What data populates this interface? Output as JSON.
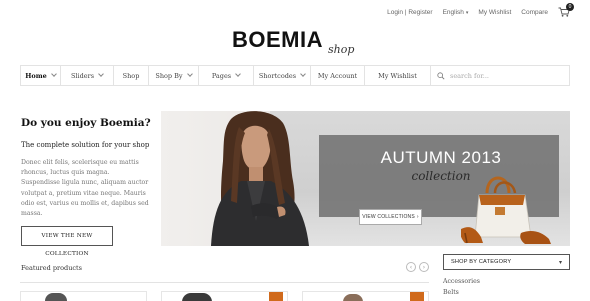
{
  "top_links": {
    "login": "Login | Register",
    "language": "English",
    "wishlist": "My Wishlist",
    "compare": "Compare",
    "cart_count": "0"
  },
  "logo": {
    "main": "BOEMIA",
    "sub": "shop"
  },
  "nav": {
    "items": [
      {
        "label": "Home",
        "dropdown": true
      },
      {
        "label": "Sliders",
        "dropdown": true
      },
      {
        "label": "Shop",
        "dropdown": false
      },
      {
        "label": "Shop By",
        "dropdown": true
      },
      {
        "label": "Pages",
        "dropdown": true
      },
      {
        "label": "Shortcodes",
        "dropdown": true
      },
      {
        "label": "My Account",
        "dropdown": false
      },
      {
        "label": "My Wishlist",
        "dropdown": false
      }
    ],
    "search_placeholder": "search for..."
  },
  "promo": {
    "heading": "Do you enjoy Boemia?",
    "subheading": "The complete solution for your shop",
    "body": "Donec elit felis, scelerisque eu mattis rhoncus, luctus quis magna. Suspendisse ligula nunc, aliquam auctor volutpat a, pretium vitae neque. Mauris odio est, varius eu mollis et, dapibus sed massa.",
    "button": "VIEW THE NEW COLLECTION"
  },
  "banner": {
    "title": "AUTUMN 2013",
    "subtitle": "collection",
    "button": "VIEW COLLECTIONS",
    "button_arrow": "›"
  },
  "featured": {
    "title": "Featured products",
    "prev": "‹",
    "next": "›"
  },
  "category": {
    "label": "SHOP BY CATEGORY",
    "items": [
      "Accessories",
      "Belts"
    ]
  },
  "colors": {
    "accent": "#d06a1c",
    "text_dark": "#111111",
    "border": "#e3e3e3"
  }
}
